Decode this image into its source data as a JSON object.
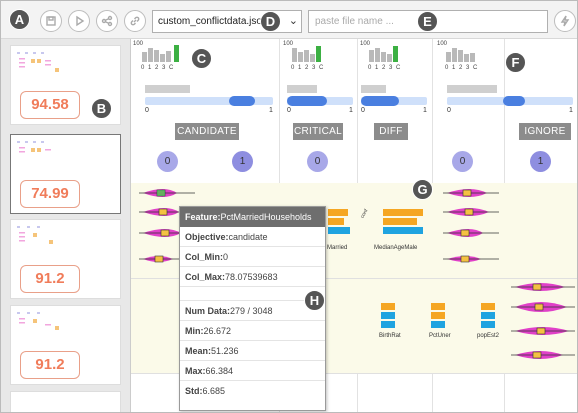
{
  "toolbar": {
    "file_name": "custom_conflictdata.json",
    "file_input_placeholder": "paste file name ...",
    "icons": [
      "home-icon",
      "save-icon",
      "play-icon",
      "share-icon",
      "link-icon",
      "lightning-icon"
    ]
  },
  "badges": {
    "a": "A",
    "b": "B",
    "c": "C",
    "d": "D",
    "e": "E",
    "f": "F",
    "g": "G",
    "h": "H"
  },
  "scores": [
    "94.58",
    "74.99",
    "91.2",
    "91.2"
  ],
  "hist_ticks": "0 1 2 3 C",
  "hist_max_label": "100",
  "range_labels": {
    "min": "0",
    "max": "1"
  },
  "groups": [
    "CANDIDATE",
    "CRITICAL",
    "DIFF",
    "IGNORE"
  ],
  "group_circles": [
    "0",
    "1",
    "0",
    "0",
    "1"
  ],
  "chart_labels": [
    "Married",
    "MedianAgeMale",
    "BirthRat",
    "PctUner",
    "popEst2"
  ],
  "tooltip": {
    "feature_label": "Feature:",
    "feature_value": "PctMarriedHouseholds",
    "objective_label": "Objective:",
    "objective_value": "candidate",
    "colmin_label": "Col_Min:",
    "colmin_value": "0",
    "colmax_label": "Col_Max:",
    "colmax_value": "78.07539683",
    "numdata_label": "Num Data:",
    "numdata_value": "279 / 3048",
    "min_label": "Min:",
    "min_value": "26.672",
    "mean_label": "Mean:",
    "mean_value": "51.236",
    "max_label": "Max:",
    "max_value": "66.384",
    "std_label": "Std:",
    "std_value": "6.685"
  },
  "colors": {
    "accent": "#4a7fe0",
    "score": "#f07c5a",
    "violin": "#e040c8",
    "bar_orange": "#f5a623",
    "bar_blue": "#1fa3e0",
    "hist_green": "#3cb043"
  }
}
